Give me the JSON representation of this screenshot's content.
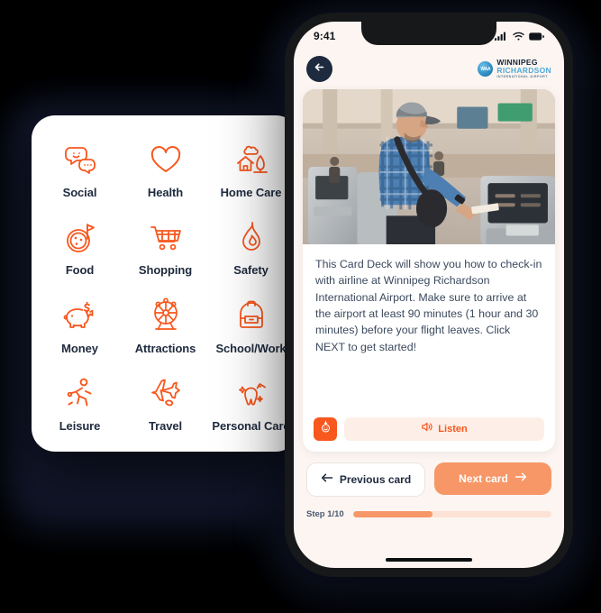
{
  "background_color": "#000000",
  "categories_panel": {
    "items": [
      {
        "label": "Social",
        "icon": "speech-bubbles-icon"
      },
      {
        "label": "Health",
        "icon": "heart-icon"
      },
      {
        "label": "Home Care",
        "icon": "house-tree-icon"
      },
      {
        "label": "Food",
        "icon": "pizza-icon"
      },
      {
        "label": "Shopping",
        "icon": "shopping-cart-icon"
      },
      {
        "label": "Safety",
        "icon": "flame-icon"
      },
      {
        "label": "Money",
        "icon": "piggy-bank-icon"
      },
      {
        "label": "Attractions",
        "icon": "ferris-wheel-icon"
      },
      {
        "label": "School/Work",
        "icon": "backpack-icon"
      },
      {
        "label": "Leisure",
        "icon": "running-person-icon"
      },
      {
        "label": "Travel",
        "icon": "airplane-icon"
      },
      {
        "label": "Personal Care",
        "icon": "tooth-brush-icon"
      }
    ],
    "accent_color": "#f8571e",
    "label_color": "#1e2a3d"
  },
  "phone": {
    "status_bar": {
      "time": "9:41",
      "icons": [
        "cellular-signal-icon",
        "wifi-icon",
        "battery-icon"
      ]
    },
    "header": {
      "back_icon": "arrow-left-icon",
      "logo": {
        "badge_text": "WAA",
        "line1": "WINNIPEG",
        "line2": "RICHARDSON",
        "line3": "INTERNATIONAL AIRPORT",
        "line1_color": "#14253c",
        "line2_color": "#4fa8d8"
      }
    },
    "card": {
      "image_alt": "man-at-airport-checkin-kiosk",
      "body_text": "This Card Deck will show you how to check-in with airline at Winnipeg Richardson International Airport. Make sure to arrive at the airport at least 90 minutes (1 hour and 30 minutes) before your flight leaves. Click NEXT to get started!",
      "emoji_button_icon": "smiley-stamp-icon",
      "listen_button": {
        "label": "Listen",
        "icon": "speaker-icon",
        "background": "#fdeee7",
        "text_color": "#f8571e"
      }
    },
    "navigation": {
      "previous": {
        "label": "Previous card",
        "icon": "arrow-left-icon"
      },
      "next": {
        "label": "Next card",
        "icon": "arrow-right-icon",
        "background": "#f79767"
      }
    },
    "progress": {
      "label": "Step 1/10",
      "current": 1,
      "total": 10,
      "percent": 40,
      "fill_color": "#f79767",
      "track_color": "#fde3d5"
    }
  }
}
